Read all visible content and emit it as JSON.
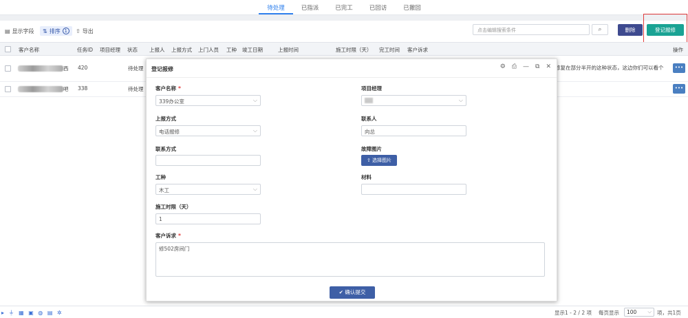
{
  "tabs": [
    "待处理",
    "已指派",
    "已完工",
    "已回访",
    "已撤回"
  ],
  "toolbar": {
    "show_fields": "显示字段",
    "sort": "排序",
    "sort_count": "1",
    "export": "导出",
    "search_placeholder": "点击编辑搜索条件",
    "delete": "删除",
    "register": "登记报修"
  },
  "table": {
    "headers": [
      "客户名称",
      "任务ID",
      "项目经理",
      "状态",
      "上报人",
      "上报方式",
      "上门人员",
      "工种",
      "竣工日期",
      "上报时间",
      "施工时限（天）",
      "完工时间",
      "客户诉求",
      "操作"
    ],
    "rows": [
      {
        "name_suffix": "西",
        "id": "420",
        "status": "待处理",
        "right_text": "修复在部分半开的这种状态，这边你们可以看个",
        "action": "•••"
      },
      {
        "name_suffix": "吧",
        "id": "338",
        "status": "待处理",
        "right_text": "",
        "action": "•••"
      }
    ]
  },
  "footer": {
    "icons": "▸ ⏚ ▦ ▣ ◍ ▤ ✲",
    "range": "显示1 - 2 / 2 项",
    "per_page_label": "每页显示",
    "per_page_value": "100",
    "total": "项，共1页"
  },
  "modal": {
    "title": "登记报修",
    "ctrl_icons": [
      "⚙",
      "⎙",
      "—",
      "⧉",
      "✕"
    ],
    "customer_label": "客户名称",
    "customer_required": "*",
    "customer_value": "339办公室",
    "pm_label": "项目经理",
    "report_method_label": "上报方式",
    "report_method_value": "电话报修",
    "contact_label": "联系人",
    "contact_value": "向总",
    "contact_info_label": "联系方式",
    "contact_info_value": "",
    "fault_image_label": "故障图片",
    "upload_label": "选择图片",
    "trade_label": "工种",
    "trade_value": "木工",
    "material_label": "材料",
    "material_value": "",
    "limit_label": "施工时限（天）",
    "limit_value": "1",
    "demand_label": "客户诉求",
    "demand_required": "*",
    "demand_value": "修502房间门",
    "submit_label": "确认提交"
  }
}
